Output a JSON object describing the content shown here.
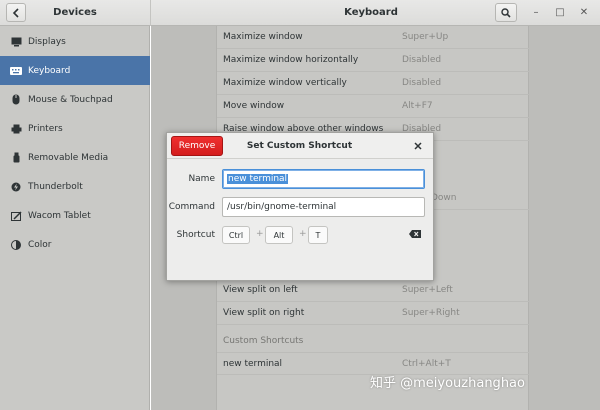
{
  "header": {
    "left_title": "Devices",
    "title": "Keyboard",
    "back_icon": "chevron-left-icon",
    "search_icon": "search-icon",
    "window_controls": {
      "minimize": "–",
      "maximize": "□",
      "close": "✕"
    }
  },
  "sidebar": {
    "items": [
      {
        "label": "Displays",
        "icon": "display-icon"
      },
      {
        "label": "Keyboard",
        "icon": "keyboard-icon",
        "selected": true
      },
      {
        "label": "Mouse & Touchpad",
        "icon": "mouse-icon"
      },
      {
        "label": "Printers",
        "icon": "printer-icon"
      },
      {
        "label": "Removable Media",
        "icon": "usb-icon"
      },
      {
        "label": "Thunderbolt",
        "icon": "thunderbolt-icon"
      },
      {
        "label": "Wacom Tablet",
        "icon": "tablet-icon"
      },
      {
        "label": "Color",
        "icon": "color-icon"
      }
    ]
  },
  "shortcuts": {
    "rows": [
      {
        "name": "Maximize window",
        "accel": "Super+Up"
      },
      {
        "name": "Maximize window horizontally",
        "accel": "Disabled"
      },
      {
        "name": "Maximize window vertically",
        "accel": "Disabled"
      },
      {
        "name": "Move window",
        "accel": "Alt+F7"
      },
      {
        "name": "Raise window above other windows",
        "accel": "Disabled"
      },
      {
        "name": "",
        "accel": "Down"
      },
      {
        "name": "View split on left",
        "accel": "Super+Left"
      },
      {
        "name": "View split on right",
        "accel": "Super+Right"
      }
    ],
    "custom_header": "Custom Shortcuts",
    "custom_rows": [
      {
        "name": "new terminal",
        "accel": "Ctrl+Alt+T"
      }
    ]
  },
  "dialog": {
    "title": "Set Custom Shortcut",
    "remove_label": "Remove",
    "name_label": "Name",
    "name_value": "new terminal",
    "command_label": "Command",
    "command_value": "/usr/bin/gnome-terminal",
    "shortcut_label": "Shortcut",
    "keys": [
      "Ctrl",
      "Alt",
      "T"
    ],
    "plus": "+",
    "close_icon": "close-icon",
    "backspace_icon": "backspace-icon"
  },
  "watermark": "知乎 @meiyouzhanghao"
}
